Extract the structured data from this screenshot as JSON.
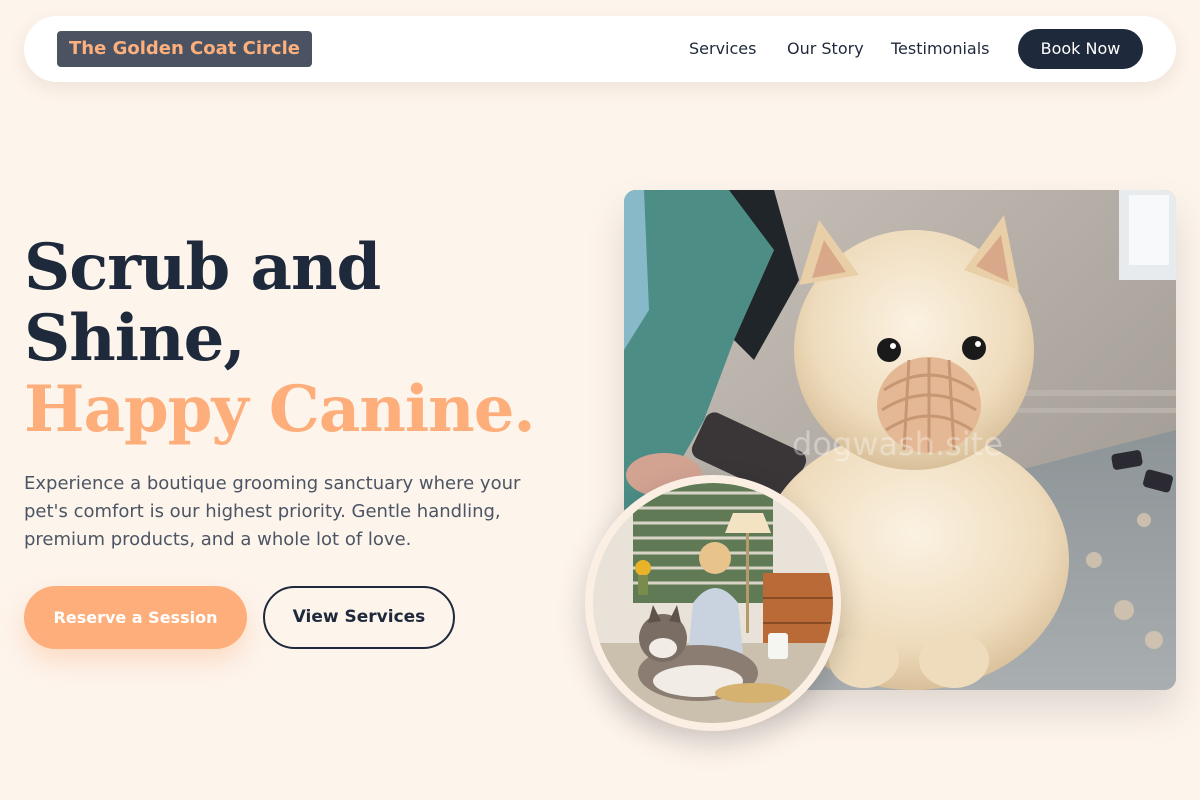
{
  "brand": {
    "name": "The Golden Coat Circle"
  },
  "nav": {
    "links": [
      "Services",
      "Our Story",
      "Testimonials"
    ],
    "cta": "Book Now"
  },
  "hero": {
    "title_line1": "Scrub and",
    "title_line2": "Shine,",
    "title_accent": "Happy Canine.",
    "description": "Experience a boutique grooming sanctuary where your pet's comfort is our highest priority. Gentle handling, premium products, and a whole lot of love.",
    "primary_cta": "Reserve a Session",
    "secondary_cta": "View Services"
  },
  "images": {
    "main_photo": "pomeranian-with-muzzle-photo",
    "inset_photo": "woman-with-husky-photo",
    "watermark": "dogwash.site"
  },
  "colors": {
    "background": "#fdf4ec",
    "accent": "#fdae7a",
    "dark": "#1e293b",
    "logo_bg": "#4b5362"
  }
}
